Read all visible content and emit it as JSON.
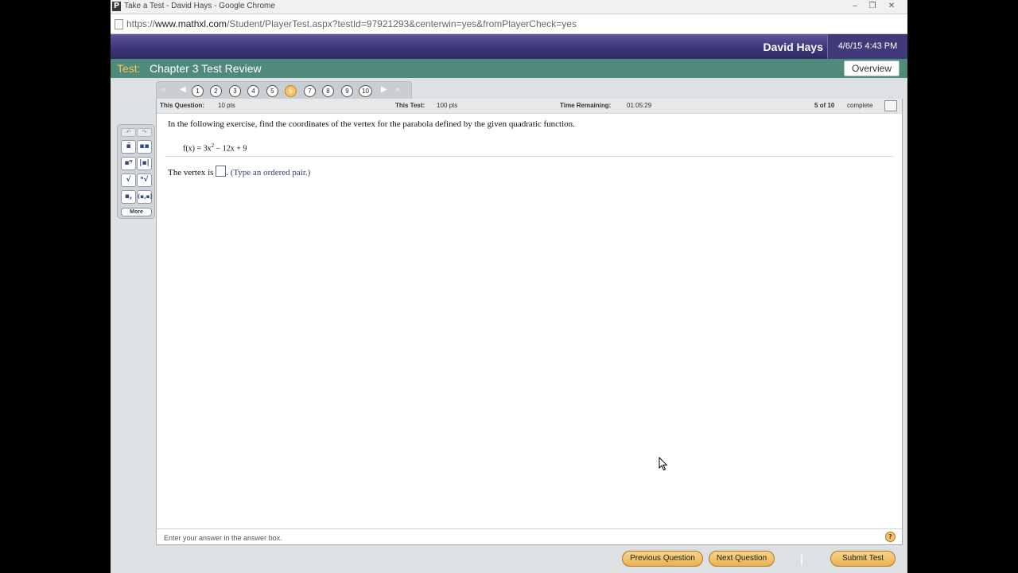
{
  "window": {
    "app_icon": "P",
    "title": "Take a Test - David Hays - Google Chrome",
    "controls": [
      "‒",
      "❐",
      "✕"
    ]
  },
  "urlbar": {
    "prefix": "https://",
    "domain": "www.mathxl.com",
    "path": "/Student/PlayerTest.aspx?testId=97921293&centerwin=yes&fromPlayerCheck=yes"
  },
  "header": {
    "user_name": "David Hays",
    "datetime": "4/6/15 4:43 PM"
  },
  "test": {
    "label": "Test:",
    "name": "Chapter 3 Test Review",
    "overview_label": "Overview"
  },
  "question_nav": {
    "first_icon": "«",
    "prev_icon": "◀",
    "next_icon": "▶",
    "last_icon": "»",
    "numbers": [
      "1",
      "2",
      "3",
      "4",
      "5",
      "6",
      "7",
      "8",
      "9",
      "10"
    ],
    "current": "6"
  },
  "infobar": {
    "this_question_label": "This Question:",
    "this_question_value": "10 pts",
    "this_test_label": "This Test:",
    "this_test_value": "100 pts",
    "time_label": "Time Remaining:",
    "time_value": "01:05:29",
    "progress": "5 of 10",
    "progress_suffix": "complete"
  },
  "question": {
    "instruction": "In the following exercise, find the coordinates of the vertex for the parabola defined by the given quadratic function.",
    "function_prefix": "f(x) = 3x",
    "function_exponent": "2",
    "function_suffix": " − 12x + 9",
    "answer_prefix": "The vertex is ",
    "answer_suffix": ".",
    "answer_hint": "(Type an ordered pair.)"
  },
  "palette": {
    "undo_icon": "↶",
    "redo_icon": "↷",
    "buttons": [
      "▪̄",
      "▪▪",
      "▪ⁿ",
      "|▪|",
      "√",
      "ⁿ√",
      "▪,",
      "(▪,▪)"
    ],
    "more_label": "More"
  },
  "footer": {
    "hint": "Enter your answer in the answer box.",
    "help_icon": "?"
  },
  "buttons": {
    "previous": "Previous Question",
    "next": "Next Question",
    "submit": "Submit Test"
  }
}
